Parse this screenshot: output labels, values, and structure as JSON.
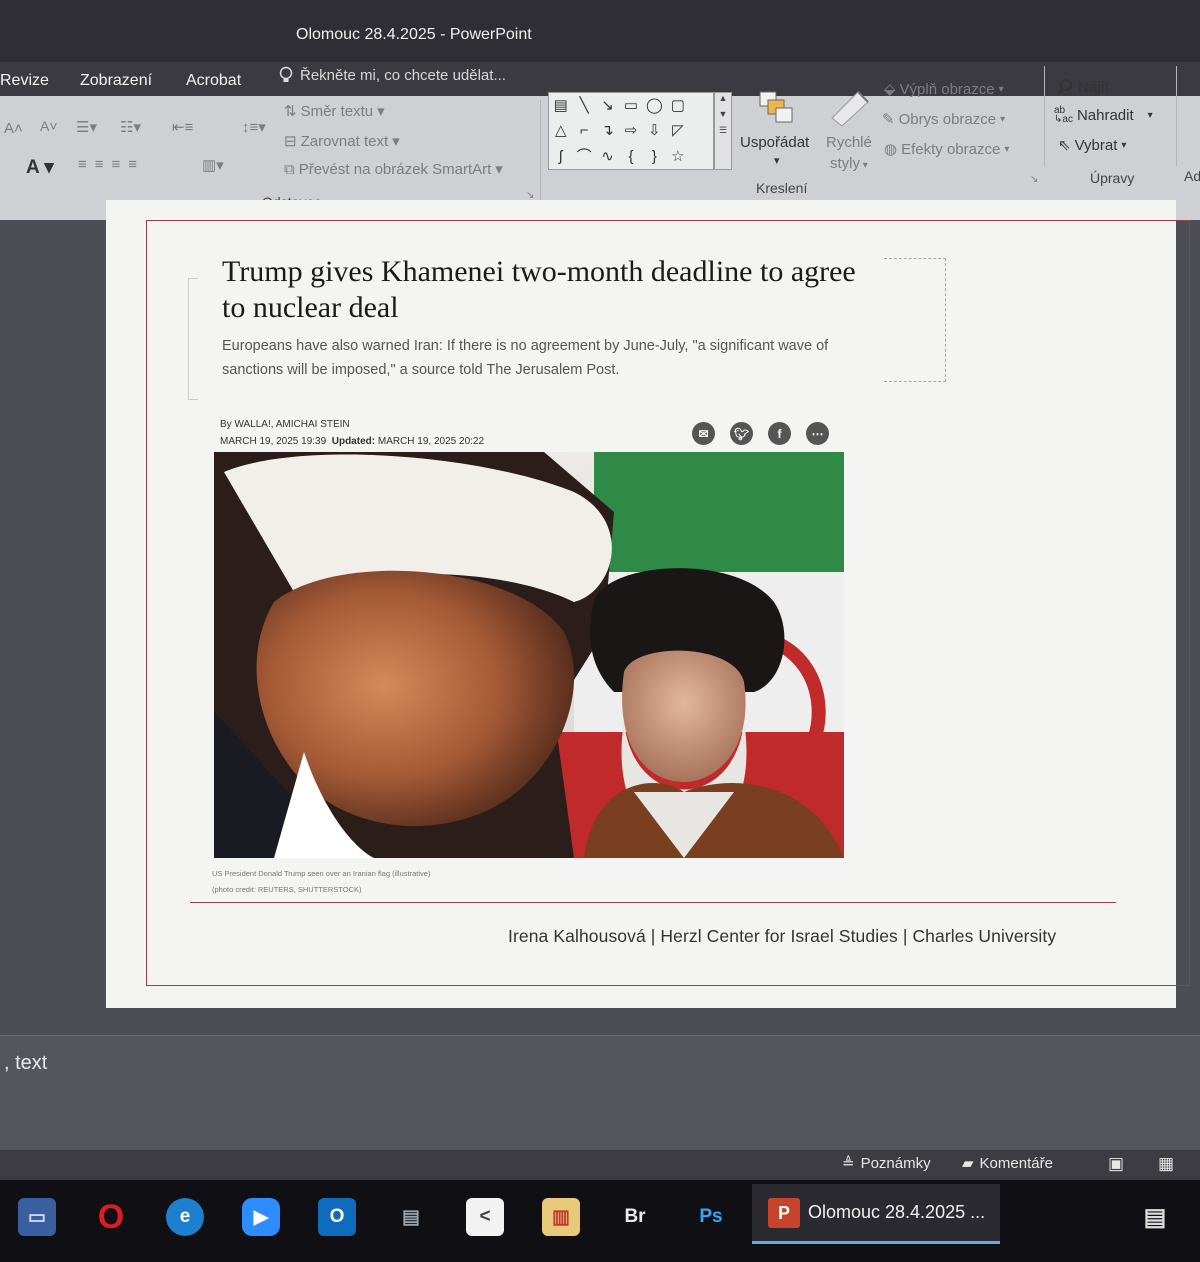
{
  "window": {
    "title": "Olomouc 28.4.2025  -  PowerPoint"
  },
  "menu": {
    "tabs": [
      "Revize",
      "Zobrazení",
      "Acrobat"
    ],
    "tell_me": "Řekněte mi, co chcete udělat..."
  },
  "ribbon": {
    "paragraph": {
      "text_direction": "Směr textu",
      "align_text": "Zarovnat text",
      "smartart": "Převést na obrázek SmartArt",
      "group_label": "Odstavec"
    },
    "drawing": {
      "arrange": "Uspořádat",
      "quick_styles_1": "Rychlé",
      "quick_styles_2": "styly",
      "shape_fill": "Výplň obrazce",
      "shape_outline": "Obrys obrazce",
      "shape_effects": "Efekty obrazce",
      "group_label": "Kreslení"
    },
    "editing": {
      "find": "Najít",
      "replace": "Nahradit",
      "select": "Vybrat",
      "group_label": "Úpravy"
    },
    "next_group_partial": "Ad"
  },
  "slide": {
    "headline": "Trump gives Khamenei two-month deadline to agree to nuclear deal",
    "subhead": "Europeans have also warned Iran: If there is no agreement by June-July, \"a significant wave of sanctions will be imposed,\" a source told The Jerusalem Post.",
    "byline": "By WALLA!, AMICHAI STEIN",
    "published": "MARCH 19, 2025 19:39",
    "updated_label": "Updated:",
    "updated": "MARCH 19, 2025 20:22",
    "caption_line1": "US President Donald Trump seen over an Iranian flag (illustrative)",
    "caption_line2": "(photo credit: REUTERS, SHUTTERSTOCK)",
    "credit": "Irena Kalhousová | Herzl Center for Israel Studies  |  Charles University"
  },
  "notes": {
    "placeholder": ", text"
  },
  "statusbar": {
    "notes": "Poznámky",
    "comments": "Komentáře"
  },
  "taskbar": {
    "active_window": "Olomouc 28.4.2025 ...",
    "bridge": "Br",
    "photoshop": "Ps",
    "ppt_letter": "P"
  }
}
